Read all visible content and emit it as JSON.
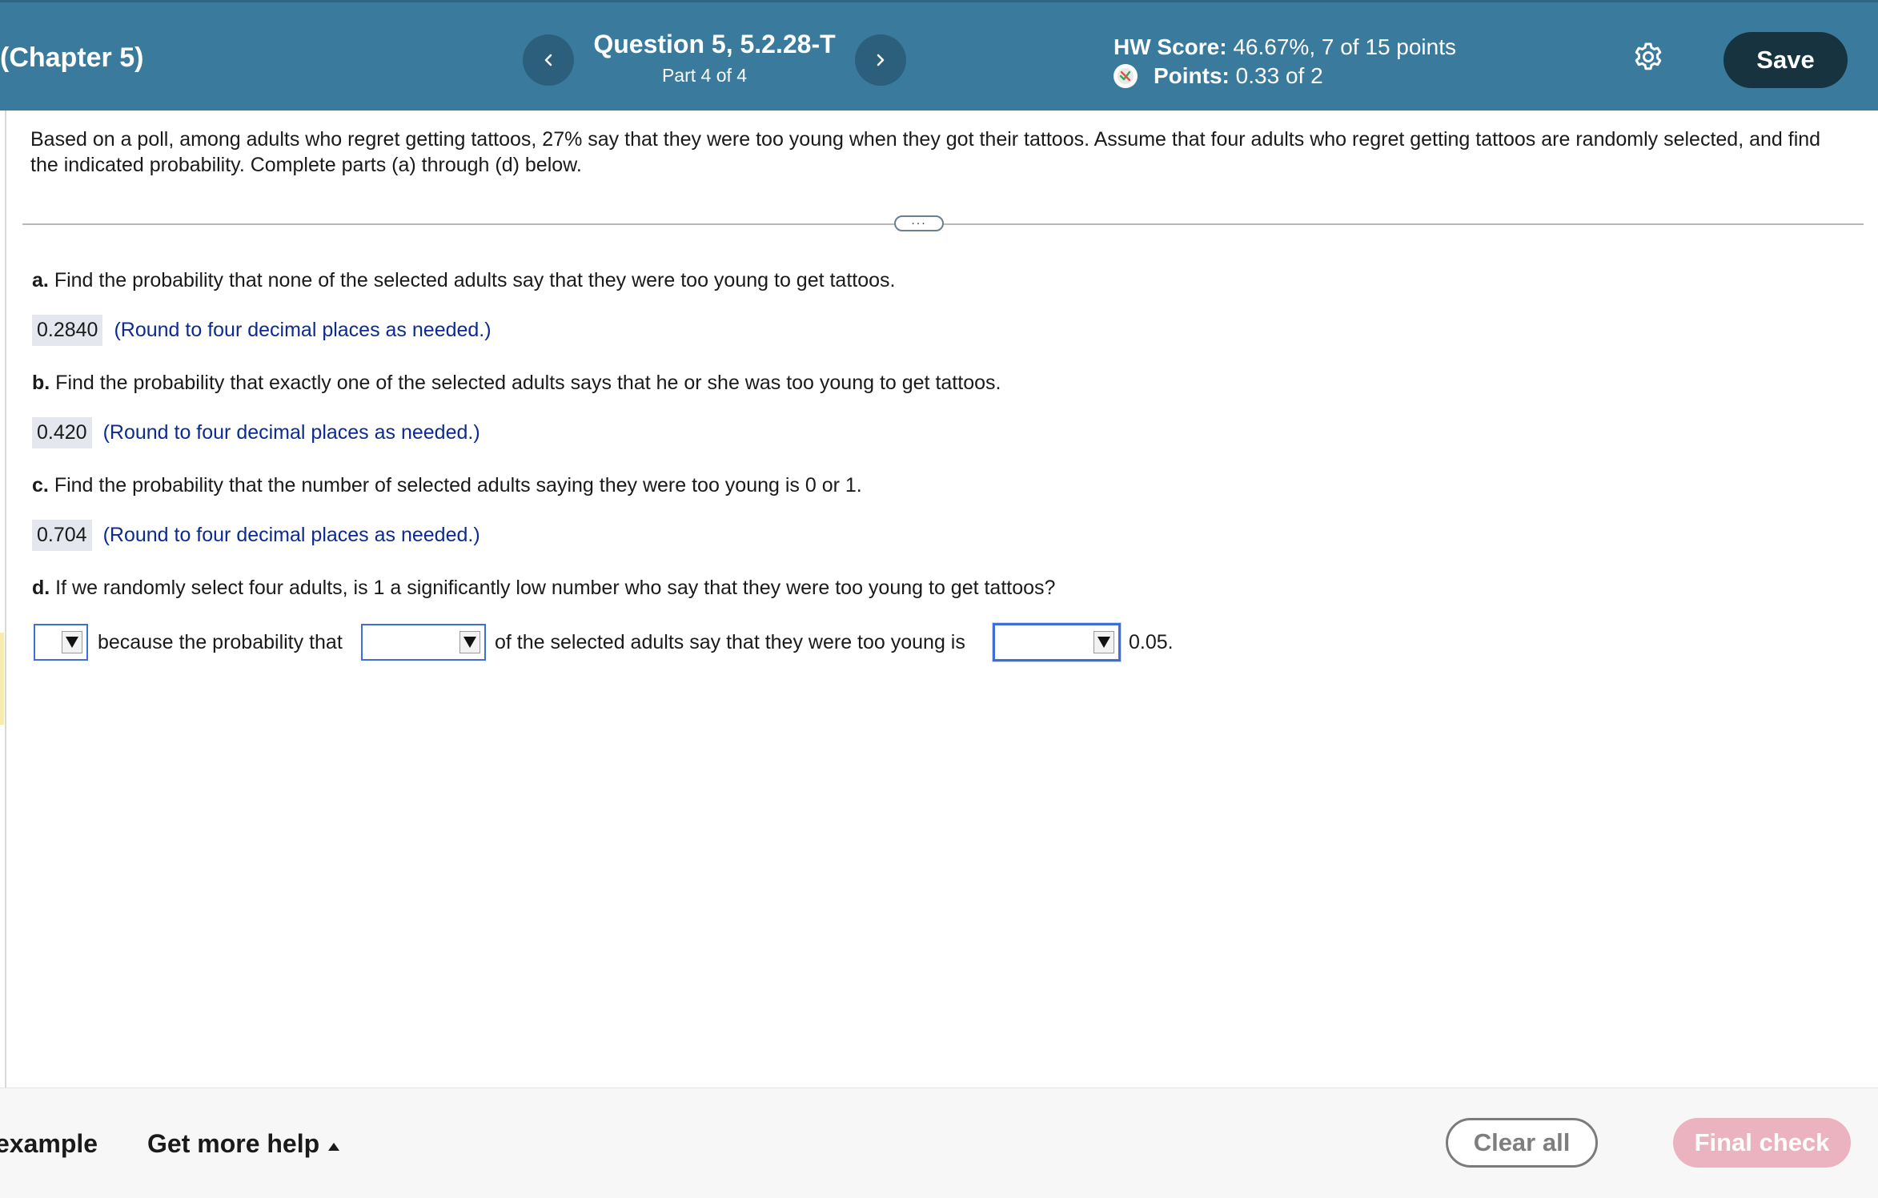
{
  "header": {
    "chapter": "(Chapter 5)",
    "question_title": "Question 5, 5.2.28-T",
    "question_part": "Part 4 of 4",
    "hw_score_label": "HW Score:",
    "hw_score_value": "46.67%, 7 of 15 points",
    "points_label": "Points:",
    "points_value": "0.33 of 2",
    "save_label": "Save",
    "nav_prev_icon": "chevron-left-icon",
    "nav_next_icon": "chevron-right-icon",
    "settings_icon": "gear-icon"
  },
  "problem": {
    "statement": "Based on a poll, among adults who regret getting tattoos, 27% say that they were too young when they got their tattoos. Assume that four adults who regret getting tattoos are randomly selected, and find the indicated probability. Complete parts (a) through (d) below.",
    "expand_label": "..."
  },
  "parts": {
    "a": {
      "letter": "a.",
      "text": "Find the probability that none of the selected adults say that they were too young to get tattoos.",
      "answer": "0.2840",
      "note": "(Round to four decimal places as needed.)"
    },
    "b": {
      "letter": "b.",
      "text": "Find the probability that exactly one of the selected adults says that he or she was too young to get tattoos.",
      "answer": "0.420",
      "note": "(Round to four decimal places as needed.)"
    },
    "c": {
      "letter": "c.",
      "text": "Find the probability that the number of selected adults saying they were too young is 0 or 1.",
      "answer": "0.704",
      "note": "(Round to four decimal places as needed.)"
    },
    "d": {
      "letter": "d.",
      "text": "If we randomly select four adults, is 1 a significantly low number who say that they were too young to get tattoos?",
      "fragment_1": "because the probability that",
      "fragment_2": "of the selected adults say that they were too young is",
      "fragment_3": "0.05.",
      "select_1_value": "",
      "select_2_value": "",
      "select_3_value": ""
    }
  },
  "footer": {
    "example_label": "example",
    "help_label": "Get more help",
    "clear_label": "Clear all",
    "final_label": "Final check"
  },
  "colors": {
    "header_bg": "#3a7a9c",
    "save_bg": "#16333f",
    "link_blue": "#0d2b8f",
    "final_check_bg": "#ebb3bf",
    "select_border": "#3e6fd8"
  }
}
